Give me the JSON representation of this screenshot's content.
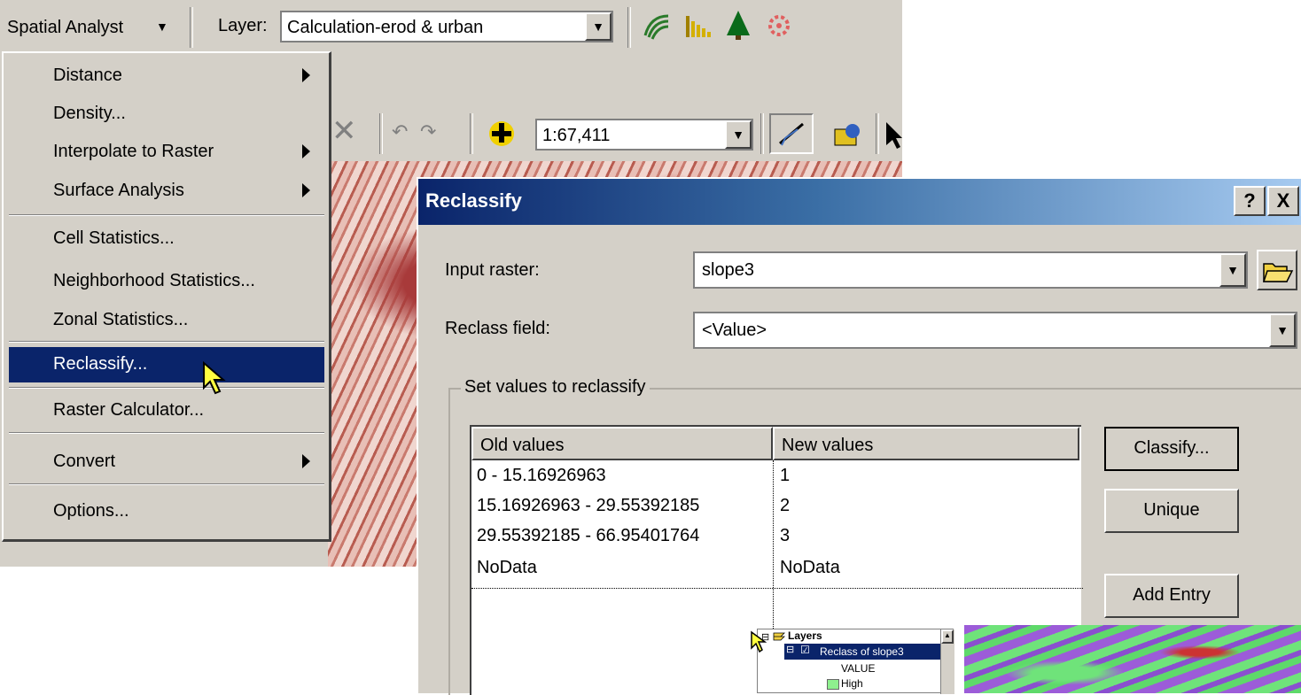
{
  "toolbar": {
    "spatial_analyst_label": "Spatial Analyst",
    "layer_label": "Layer:",
    "layer_value": "Calculation-erod & urban",
    "scale_value": "1:67,411"
  },
  "menu": {
    "items": [
      {
        "label": "Distance",
        "submenu": true
      },
      {
        "label": "Density...",
        "submenu": false
      },
      {
        "label": "Interpolate to Raster",
        "submenu": true
      },
      {
        "label": "Surface Analysis",
        "submenu": true
      },
      {
        "label": "Cell Statistics...",
        "submenu": false
      },
      {
        "label": "Neighborhood Statistics...",
        "submenu": false
      },
      {
        "label": "Zonal Statistics...",
        "submenu": false
      },
      {
        "label": "Reclassify...",
        "submenu": false,
        "selected": true
      },
      {
        "label": "Raster Calculator...",
        "submenu": false
      },
      {
        "label": "Convert",
        "submenu": true
      },
      {
        "label": "Options...",
        "submenu": false
      }
    ]
  },
  "dialog": {
    "title": "Reclassify",
    "help_label": "?",
    "close_label": "X",
    "input_raster_label": "Input raster:",
    "input_raster_value": "slope3",
    "reclass_field_label": "Reclass field:",
    "reclass_field_value": "<Value>",
    "group_label": "Set values to reclassify",
    "table": {
      "columns": [
        "Old values",
        "New values"
      ],
      "rows": [
        {
          "old": "0 - 15.16926963",
          "new": "1"
        },
        {
          "old": "15.16926963 - 29.55392185",
          "new": "2"
        },
        {
          "old": "29.55392185 - 66.95401764",
          "new": "3"
        },
        {
          "old": "NoData",
          "new": "NoData"
        }
      ]
    },
    "buttons": {
      "classify": "Classify...",
      "unique": "Unique",
      "add_entry": "Add Entry"
    }
  },
  "toc": {
    "root": "Layers",
    "layer": "Reclass of slope3",
    "field": "VALUE",
    "class": "High"
  },
  "colors": {
    "selection": "#0a246a",
    "face": "#d4d0c8"
  }
}
